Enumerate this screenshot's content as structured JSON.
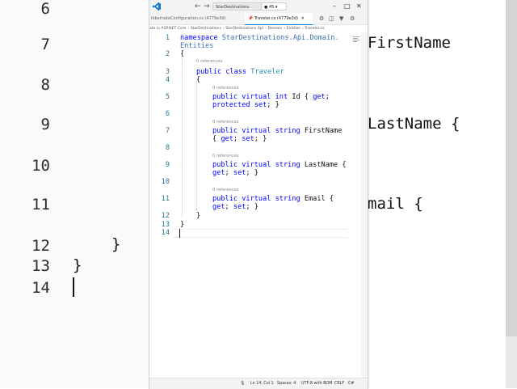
{
  "background": {
    "line_numbers": [
      "6",
      "7",
      "8",
      "9",
      "10",
      "11",
      "12",
      "13",
      "14"
    ],
    "fragments": {
      "right_firstname": "FirstName",
      "right_lastname": "LastName {",
      "right_email": "mail {",
      "brace_close_inner": "}",
      "brace_close_outer": "}"
    }
  },
  "window": {
    "search_text": "StarDestinations",
    "counter": "45",
    "tabs": [
      {
        "label": "hibernateConfiguration.cs (4779e3d)"
      },
      {
        "label": "Traveler.cs (4779e3d)"
      }
    ],
    "breadcrumb": [
      "ate in ASP.NET Core",
      "StarDestinations",
      "StarDestinations.Api",
      "Domain",
      "Entities",
      "Traveler.cs"
    ]
  },
  "editor": {
    "lines": [
      {
        "n": "1",
        "segments": [
          {
            "t": "namespace ",
            "c": "kw"
          },
          {
            "t": "StarDestinations.Api.Domain.",
            "c": "ns"
          }
        ]
      },
      {
        "n": "",
        "segments": [
          {
            "t": "Entities",
            "c": "ns"
          }
        ]
      },
      {
        "n": "2",
        "segments": [
          {
            "t": "{",
            "c": ""
          }
        ]
      },
      {
        "n": "3",
        "segments": [
          {
            "t": "public class ",
            "c": "kw"
          },
          {
            "t": "Traveler",
            "c": "ty"
          }
        ]
      },
      {
        "n": "4",
        "segments": [
          {
            "t": "{",
            "c": ""
          }
        ]
      },
      {
        "n": "5",
        "segments": [
          {
            "t": "public virtual int ",
            "c": "kw"
          },
          {
            "t": "Id { ",
            "c": ""
          },
          {
            "t": "get",
            "c": "kw"
          },
          {
            "t": ";",
            "c": ""
          }
        ]
      },
      {
        "n": "",
        "segments": [
          {
            "t": "protected set",
            "c": "kw"
          },
          {
            "t": "; }",
            "c": ""
          }
        ]
      },
      {
        "n": "6",
        "segments": []
      },
      {
        "n": "7",
        "segments": [
          {
            "t": "public virtual string ",
            "c": "kw"
          },
          {
            "t": "FirstName",
            "c": ""
          }
        ]
      },
      {
        "n": "",
        "segments": [
          {
            "t": "{ ",
            "c": ""
          },
          {
            "t": "get",
            "c": "kw"
          },
          {
            "t": "; ",
            "c": ""
          },
          {
            "t": "set",
            "c": "kw"
          },
          {
            "t": "; }",
            "c": ""
          }
        ]
      },
      {
        "n": "8",
        "segments": []
      },
      {
        "n": "9",
        "segments": [
          {
            "t": "public virtual string ",
            "c": "kw"
          },
          {
            "t": "LastName {",
            "c": ""
          }
        ]
      },
      {
        "n": "",
        "segments": [
          {
            "t": "get",
            "c": "kw"
          },
          {
            "t": "; ",
            "c": ""
          },
          {
            "t": "set",
            "c": "kw"
          },
          {
            "t": "; }",
            "c": ""
          }
        ]
      },
      {
        "n": "10",
        "segments": []
      },
      {
        "n": "11",
        "segments": [
          {
            "t": "public virtual string ",
            "c": "kw"
          },
          {
            "t": "Email {",
            "c": ""
          }
        ]
      },
      {
        "n": "",
        "segments": [
          {
            "t": "get",
            "c": "kw"
          },
          {
            "t": "; ",
            "c": ""
          },
          {
            "t": "set",
            "c": "kw"
          },
          {
            "t": "; }",
            "c": ""
          }
        ]
      },
      {
        "n": "12",
        "segments": [
          {
            "t": "}",
            "c": ""
          }
        ]
      },
      {
        "n": "13",
        "segments": [
          {
            "t": "}",
            "c": ""
          }
        ]
      },
      {
        "n": "14",
        "segments": []
      }
    ],
    "references_label": "0 references"
  },
  "status": {
    "position": "Ln 14, Col 1",
    "spaces": "Spaces: 4",
    "encoding": "UTF-8 with BOM",
    "eol": "CRLF",
    "language": "C#"
  },
  "colors": {
    "keyword": "#0000ff",
    "type": "#2b91af",
    "namespace": "#3c6fb0",
    "accent": "#0078d4"
  }
}
